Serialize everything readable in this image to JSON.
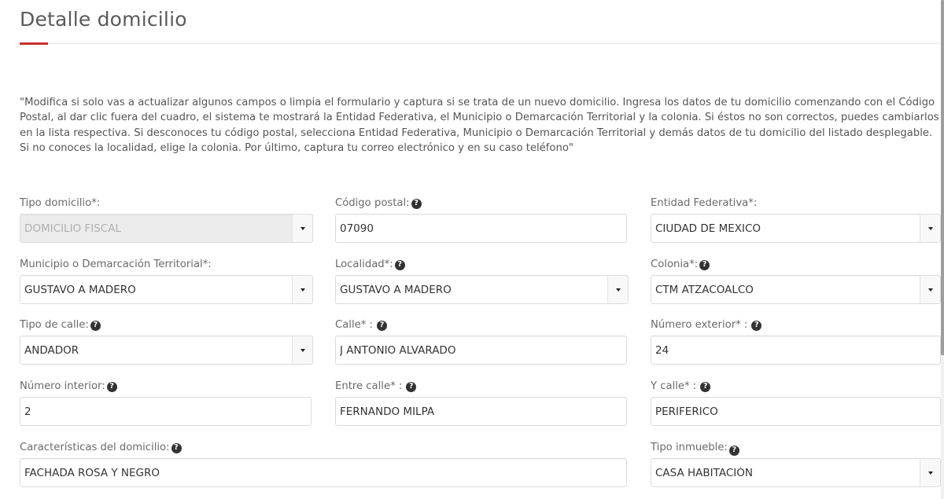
{
  "header": {
    "title": "Detalle domicilio",
    "accent_color": "#c8302e"
  },
  "instructions": "\"Modifica si solo vas a actualizar algunos campos o limpia el formulario y captura si se trata de un nuevo domicilio. Ingresa los datos de tu domicilio comenzando con el Código Postal, al dar clic fuera del cuadro, el sistema te mostrará la Entidad Federativa, el Municipio o Demarcación Territorial y la colonia. Si éstos no son correctos, puedes cambiarlos en la lista respectiva. Si desconoces tu código postal, selecciona Entidad Federativa, Municipio o Demarcación Territorial y demás datos de tu domicilio del listado desplegable. Si no conoces la localidad, elige la colonia. Por último, captura tu correo electrónico y en su caso teléfono\"",
  "form": {
    "tipo_domicilio": {
      "label": "Tipo domicilio*:",
      "value": "DOMICILIO FISCAL",
      "type": "select",
      "disabled": true
    },
    "codigo_postal": {
      "label": "Código postal:",
      "value": "07090",
      "type": "text",
      "help_icon": "question-circle-icon"
    },
    "entidad_federativa": {
      "label": "Entidad Federativa*:",
      "value": "CIUDAD DE MEXICO",
      "type": "select"
    },
    "municipio": {
      "label": "Municipio o Demarcación Territorial*:",
      "value": "GUSTAVO A MADERO",
      "type": "select"
    },
    "localidad": {
      "label": "Localidad*:",
      "value": "GUSTAVO A MADERO",
      "type": "select",
      "help_icon": "question-circle-icon"
    },
    "colonia": {
      "label": "Colonia*:",
      "value": "CTM ATZACOALCO",
      "type": "select",
      "help_icon": "question-circle-icon"
    },
    "tipo_calle": {
      "label": "Tipo de calle:",
      "value": "ANDADOR",
      "type": "select",
      "help_icon": "question-circle-icon"
    },
    "calle": {
      "label": "Calle* :",
      "value": "J ANTONIO ALVARADO",
      "type": "text",
      "help_icon": "question-circle-icon"
    },
    "numero_exterior": {
      "label": "Número exterior* :",
      "value": "24",
      "type": "text",
      "help_icon": "question-circle-icon"
    },
    "numero_interior": {
      "label": "Número interior:",
      "value": "2",
      "type": "text",
      "help_icon": "question-circle-icon"
    },
    "entre_calle": {
      "label": "Entre calle* :",
      "value": "FERNANDO MILPA",
      "type": "text",
      "help_icon": "question-circle-icon"
    },
    "y_calle": {
      "label": "Y calle* :",
      "value": "PERIFERICO",
      "type": "text",
      "help_icon": "question-circle-icon"
    },
    "caracteristicas": {
      "label": "Características del domicilio:",
      "value": "FACHADA ROSA Y NEGRO",
      "type": "text",
      "help_icon": "question-circle-icon"
    },
    "tipo_inmueble": {
      "label": "Tipo inmueble:",
      "value": "CASA HABITACIÓN",
      "type": "select",
      "help_icon": "question-circle-icon"
    }
  },
  "icons": {
    "help_glyph": "?"
  }
}
